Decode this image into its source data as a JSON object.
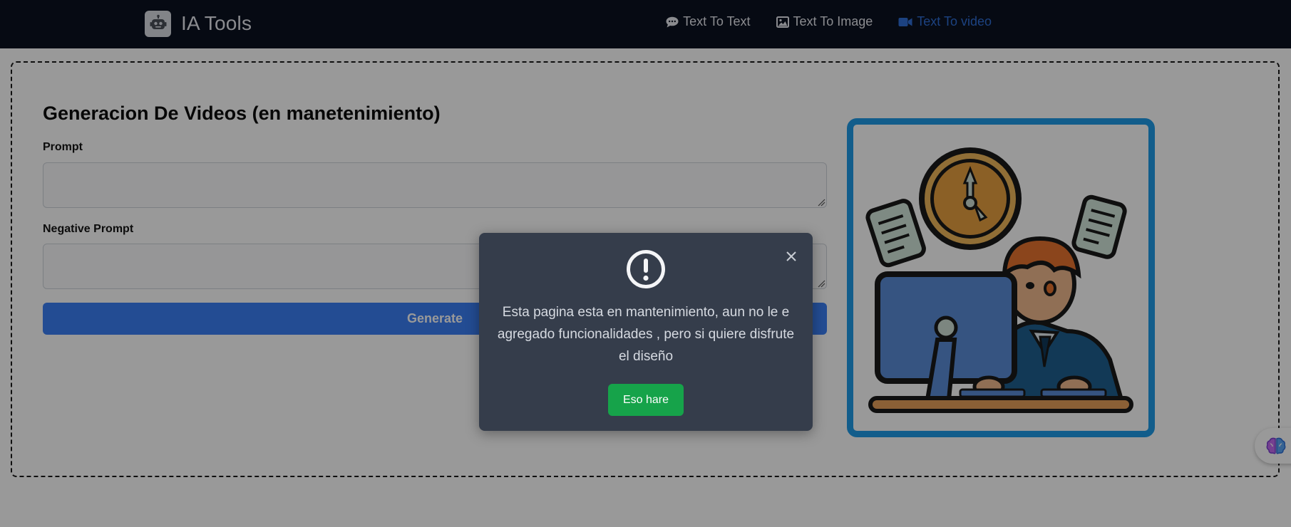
{
  "navbar": {
    "brand": "IA Tools",
    "links": [
      {
        "label": "Text To Text",
        "icon": "chat-icon",
        "active": false
      },
      {
        "label": "Text To Image",
        "icon": "image-icon",
        "active": false
      },
      {
        "label": "Text To video",
        "icon": "video-icon",
        "active": true
      }
    ]
  },
  "main": {
    "title": "Generacion De Videos (en manetenimiento)",
    "prompt_label": "Prompt",
    "prompt_value": "",
    "negative_prompt_label": "Negative Prompt",
    "negative_prompt_value": "",
    "generate_label": "Generate"
  },
  "modal": {
    "icon": "exclamation-circle-icon",
    "message": "Esta pagina esta en mantenimiento, aun no le e agregado funcionalidades , pero si quiere disfrute el diseño",
    "confirm_label": "Eso hare"
  },
  "colors": {
    "navbar_bg": "#0b1220",
    "active_link": "#2f6fd8",
    "primary_button": "#3b7ff5",
    "modal_bg": "#353d4b",
    "confirm_button": "#16a34a",
    "illustration_border": "#1e9be8"
  }
}
